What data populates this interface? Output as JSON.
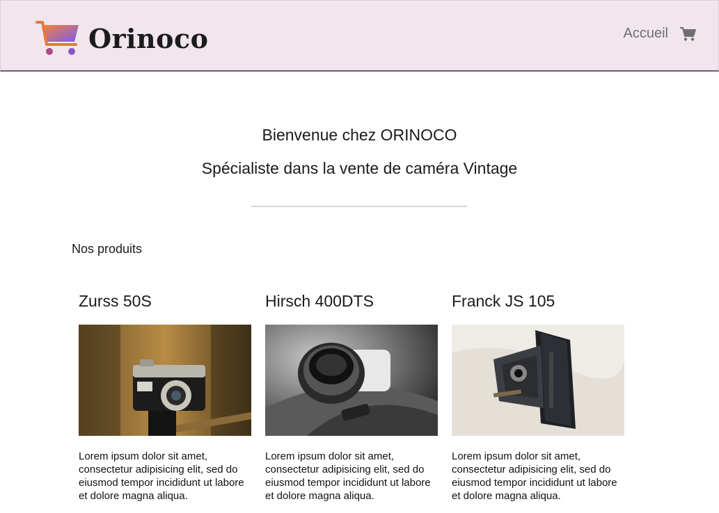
{
  "header": {
    "logo_text": "Orinoco",
    "nav": {
      "home_label": "Accueil"
    }
  },
  "welcome": {
    "line1": "Bienvenue chez ORINOCO",
    "line2": "Spécialiste dans la vente de caméra Vintage"
  },
  "products_section": {
    "title": "Nos produits",
    "items": [
      {
        "name": "Zurss 50S",
        "description": "Lorem ipsum dolor sit amet, consectetur adipisicing elit, sed do eiusmod tempor incididunt ut labore et dolore magna aliqua."
      },
      {
        "name": "Hirsch 400DTS",
        "description": "Lorem ipsum dolor sit amet, consectetur adipisicing elit, sed do eiusmod tempor incididunt ut labore et dolore magna aliqua."
      },
      {
        "name": "Franck JS 105",
        "description": "Lorem ipsum dolor sit amet, consectetur adipisicing elit, sed do eiusmod tempor incididunt ut labore et dolore magna aliqua."
      }
    ]
  },
  "colors": {
    "header_bg": "#f2e6ee",
    "cart_gradient_start": "#f0803c",
    "cart_gradient_end": "#7a5cf0"
  },
  "icons": [
    "shopping-cart-logo-icon",
    "cart-icon"
  ]
}
